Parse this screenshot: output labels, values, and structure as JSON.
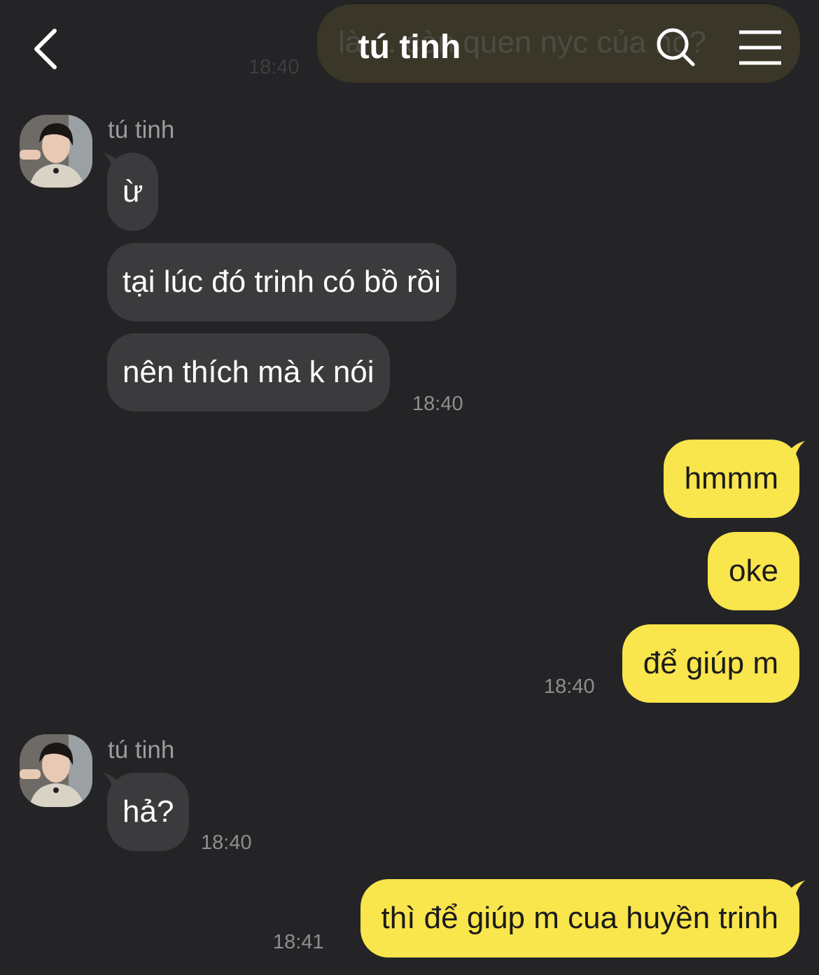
{
  "header": {
    "title": "tú tinh",
    "back_icon": "chevron-left-icon",
    "search_icon": "search-icon",
    "menu_icon": "hamburger-menu-icon"
  },
  "ghost": {
    "text": "là ... còn quen nyc của nó?",
    "time": "18:40"
  },
  "groups": [
    {
      "sender": "tú tinh",
      "messages": [
        "ừ",
        "tại lúc đó trinh có bồ rồi",
        "nên thích mà k nói"
      ],
      "time": "18:40"
    },
    {
      "outgoing": true,
      "messages": [
        "hmmm",
        "oke",
        "để giúp m"
      ],
      "time": "18:40"
    },
    {
      "sender": "tú tinh",
      "messages": [
        "hả?"
      ],
      "time": "18:40"
    },
    {
      "outgoing": true,
      "messages": [
        "thì để giúp m cua huyền trinh"
      ],
      "time": "18:41"
    }
  ],
  "colors": {
    "background": "#242426",
    "incoming_bubble": "#3b3b3d",
    "outgoing_bubble": "#f9e54c",
    "timestamp": "#8e8e90"
  }
}
